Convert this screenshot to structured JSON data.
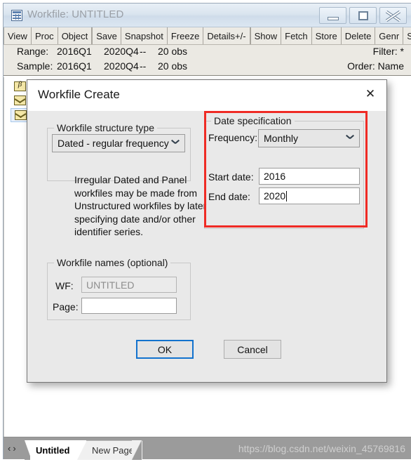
{
  "window": {
    "title": "Workfile: UNTITLED",
    "icon": "workfile-grid-icon",
    "caption_buttons": {
      "minimize": "minimize-icon",
      "maximize": "maximize-icon",
      "close": "close-icon"
    }
  },
  "toolbar": {
    "buttons": [
      "View",
      "Proc",
      "Object",
      "Save",
      "Snapshot",
      "Freeze",
      "Details+/-",
      "Show",
      "Fetch",
      "Store",
      "Delete",
      "Genr",
      "Sample"
    ]
  },
  "info": {
    "range_label": "Range:",
    "range_start": "2016Q1",
    "range_end": "2020Q4",
    "range_dash": "--",
    "range_obs": "20 obs",
    "sample_label": "Sample:",
    "sample_start": "2016Q1",
    "sample_end": "2020Q4",
    "sample_dash": "--",
    "sample_obs": "20 obs",
    "filter": "Filter: *",
    "order": "Order: Name"
  },
  "objects": [
    {
      "icon": "coefficient-beta-icon",
      "selected": false
    },
    {
      "icon": "series-envelope-icon",
      "selected": false
    },
    {
      "icon": "series-envelope-icon",
      "selected": true
    }
  ],
  "tabs": {
    "nav_prev": "‹",
    "nav_next": "›",
    "items": [
      {
        "label": "Untitled",
        "active": true
      },
      {
        "label": "New Page",
        "active": false
      }
    ]
  },
  "watermark": "https://blog.csdn.net/weixin_45769816",
  "dialog": {
    "title": "Workfile Create",
    "close_icon": "✕",
    "structure": {
      "legend": "Workfile structure type",
      "selected": "Dated - regular frequency",
      "chevron": "chevron-down-icon"
    },
    "help_text": "Irregular Dated and Panel workfiles may be made from Unstructured workfiles by later specifying date and/or other identifier series.",
    "date_spec": {
      "legend": "Date specification",
      "frequency_label": "Frequency:",
      "frequency_value": "Monthly",
      "frequency_chevron": "chevron-down-icon",
      "start_label": "Start date:",
      "start_value": "2016",
      "end_label": "End date:",
      "end_value": "2020",
      "highlight_color": "#ef2b25"
    },
    "names": {
      "legend": "Workfile names (optional)",
      "wf_label": "WF:",
      "wf_placeholder": "UNTITLED",
      "page_label": "Page:",
      "page_value": ""
    },
    "buttons": {
      "ok": "OK",
      "cancel": "Cancel",
      "focus_color": "#1272ce"
    }
  }
}
